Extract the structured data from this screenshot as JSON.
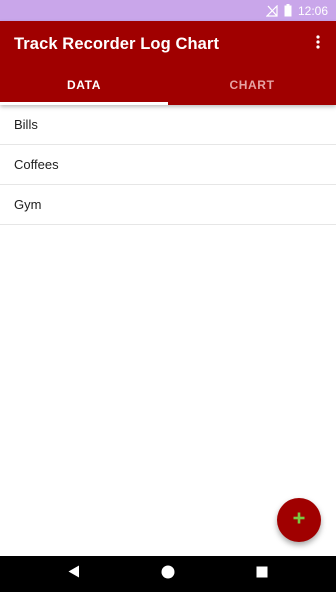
{
  "status_bar": {
    "time": "12:06",
    "icons": [
      "signal-off-icon",
      "battery-icon"
    ]
  },
  "app_bar": {
    "title": "Track Recorder Log Chart",
    "overflow_icon": "more-vert-icon",
    "color": "#a00000"
  },
  "tabs": [
    {
      "label": "DATA",
      "active": true
    },
    {
      "label": "CHART",
      "active": false
    }
  ],
  "list": {
    "items": [
      {
        "label": "Bills"
      },
      {
        "label": "Coffees"
      },
      {
        "label": "Gym"
      }
    ]
  },
  "fab": {
    "icon": "plus-icon",
    "icon_color": "#7ac943"
  },
  "nav_bar": {
    "icons": [
      "back-icon",
      "home-icon",
      "recents-icon"
    ]
  },
  "colors": {
    "status_bar": "#c9a6ea",
    "primary": "#a00000",
    "inactive_tab": "#e6a3a3"
  }
}
